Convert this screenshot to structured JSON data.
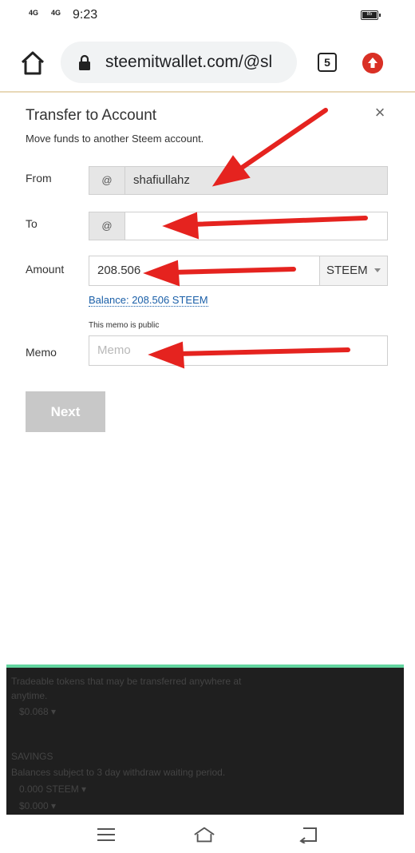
{
  "status": {
    "sig1": "4G",
    "sig2": "4G",
    "time": "9:23",
    "battery": "85"
  },
  "browser": {
    "url": "steemitwallet.com/@sl",
    "tab_count": "5"
  },
  "modal": {
    "title": "Transfer to Account",
    "subtitle": "Move funds to another Steem account.",
    "from_label": "From",
    "from_at": "@",
    "from_value": "shafiullahz",
    "to_label": "To",
    "to_at": "@",
    "to_value": "",
    "amount_label": "Amount",
    "amount_value": "208.506",
    "currency": "STEEM",
    "balance": "Balance: 208.506 STEEM",
    "memo_note": "This memo is public",
    "memo_label": "Memo",
    "memo_placeholder": "Memo",
    "next_label": "Next",
    "close": "×"
  },
  "background_page": {
    "line1": "Tradeable tokens that may be transferred anywhere at",
    "line2": "anytime.",
    "line3": "$0.068 ▾",
    "savings_heading": "SAVINGS",
    "savings_desc": "Balances subject to 3 day withdraw waiting period.",
    "savings_steem": "0.000 STEEM ▾",
    "savings_usd": "$0.000 ▾"
  },
  "colors": {
    "arrow": "#e5231f",
    "link": "#1a5fa8",
    "accent_line": "#63d5a0"
  }
}
